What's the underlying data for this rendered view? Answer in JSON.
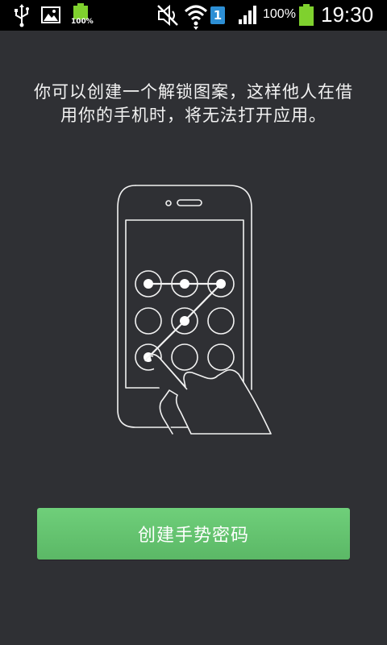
{
  "status_bar": {
    "battery_small_label": "100%",
    "sim_badge": "1",
    "battery_percent": "100%",
    "time": "19:30",
    "icons": [
      "usb-icon",
      "image-icon",
      "battery-icon",
      "mute-icon",
      "wifi-icon",
      "sim-icon",
      "signal-icon",
      "battery-icon"
    ]
  },
  "intro": {
    "description": "你可以创建一个解锁图案，这样他人在借用你的手机时，将无法打开应用。"
  },
  "actions": {
    "create_pattern_label": "创建手势密码"
  },
  "colors": {
    "background": "#2f3034",
    "button_green": "#5bb866",
    "sim_blue": "#2d8fd5",
    "battery_green": "#7fd12e"
  }
}
